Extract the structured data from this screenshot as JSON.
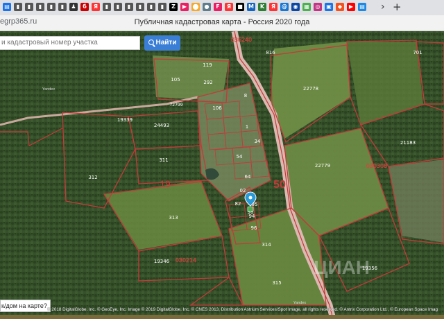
{
  "browser": {
    "tabs": [
      {
        "icon": "folder-icon",
        "color": "#1a73e8",
        "glyph": "▤"
      },
      {
        "icon": "bookmark-icon",
        "color": "#555",
        "glyph": "▮"
      },
      {
        "icon": "bookmark-icon",
        "color": "#555",
        "glyph": "▮"
      },
      {
        "icon": "bookmark-icon",
        "color": "#555",
        "glyph": "▮"
      },
      {
        "icon": "bookmark-icon",
        "color": "#555",
        "glyph": "▮"
      },
      {
        "icon": "bookmark-icon",
        "color": "#555",
        "glyph": "▮"
      },
      {
        "icon": "pawn-icon",
        "color": "#333",
        "glyph": "♟"
      },
      {
        "icon": "site-icon",
        "color": "#c00",
        "glyph": "б"
      },
      {
        "icon": "yandex-icon",
        "color": "#f33",
        "glyph": "Я"
      },
      {
        "icon": "bookmark-icon",
        "color": "#555",
        "glyph": "▮"
      },
      {
        "icon": "bookmark-icon",
        "color": "#555",
        "glyph": "▮"
      },
      {
        "icon": "bookmark-icon",
        "color": "#555",
        "glyph": "▮"
      },
      {
        "icon": "bookmark-icon",
        "color": "#555",
        "glyph": "▮"
      },
      {
        "icon": "bookmark-icon",
        "color": "#555",
        "glyph": "▮"
      },
      {
        "icon": "bookmark-icon",
        "color": "#555",
        "glyph": "▮"
      },
      {
        "icon": "site-icon",
        "color": "#000",
        "glyph": "Z"
      },
      {
        "icon": "site-icon",
        "color": "#e91e63",
        "glyph": "▶"
      },
      {
        "icon": "site-icon",
        "color": "#f9a825",
        "glyph": "⬤"
      },
      {
        "icon": "site-icon",
        "color": "#607d8b",
        "glyph": "●"
      },
      {
        "icon": "site-icon",
        "color": "#e91e63",
        "glyph": "F"
      },
      {
        "icon": "yandex-icon",
        "color": "#f33",
        "glyph": "Я"
      },
      {
        "icon": "flag-icon",
        "color": "#000",
        "glyph": "■"
      },
      {
        "icon": "site-icon",
        "color": "#1565c0",
        "glyph": "M"
      },
      {
        "icon": "site-icon",
        "color": "#2e7d32",
        "glyph": "K"
      },
      {
        "icon": "yandex-icon",
        "color": "#f33",
        "glyph": "Я"
      },
      {
        "icon": "site-icon",
        "color": "#1976d2",
        "glyph": "@"
      },
      {
        "icon": "site-icon",
        "color": "#0d47a1",
        "glyph": "◉"
      },
      {
        "icon": "site-icon",
        "color": "#4caf50",
        "glyph": "▦"
      },
      {
        "icon": "instagram-icon",
        "color": "#c13584",
        "glyph": "◎"
      },
      {
        "icon": "site-icon",
        "color": "#1a73e8",
        "glyph": "▣"
      },
      {
        "icon": "site-icon",
        "color": "#f4511e",
        "glyph": "◆"
      },
      {
        "icon": "youtube-icon",
        "color": "#f00",
        "glyph": "▶"
      },
      {
        "icon": "site-icon",
        "color": "#1e88e5",
        "glyph": "▤"
      }
    ],
    "tab_arrow": "›",
    "new_tab": "+"
  },
  "page": {
    "url": "egrp365.ru",
    "title": "Публичная кадастровая карта - Россия 2020 года"
  },
  "search": {
    "placeholder": "и кадастровый номер участка",
    "button": "Найти"
  },
  "bottom_button": "к/дом на карте?",
  "attribution": "© 2018 DigitalGlobe, Inc. © GeoEye, Inc. Image © 2019 DigitalGlobe, Inc. © CNES 2013, Distribution Astrium Services/Spot Image, all rights reserved. © Antrix Corporation Ltd., © European Space Imag",
  "watermark": "ЦИАН",
  "map": {
    "colors": {
      "parcel": "#c43a3a",
      "road": "#d9b9b0",
      "field": "#6c8a44",
      "forest": "#2f4a22"
    },
    "road_sign": "50",
    "place_labels": [
      "Yandex",
      "Yandex"
    ],
    "parcels": [
      "105",
      "119",
      "292",
      "22778",
      "22779",
      "24493",
      "19339",
      "311",
      "312",
      "313",
      "314",
      "315",
      "19346",
      "19356",
      "21183",
      "701",
      "816",
      "106",
      "8",
      "1",
      "54",
      "34",
      "64",
      "82",
      "94",
      "96",
      "95",
      "98",
      "02",
      "19"
    ],
    "quarter_labels": [
      "030308",
      "030214",
      "036240"
    ],
    "road_labels": [
      "72799"
    ]
  }
}
